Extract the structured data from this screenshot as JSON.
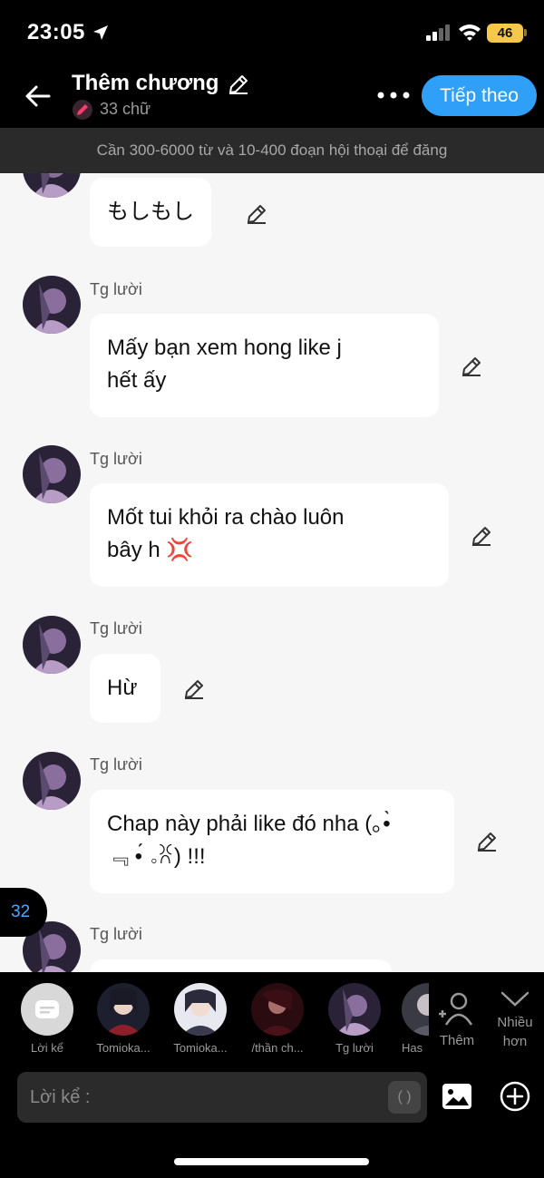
{
  "status": {
    "time": "23:05",
    "battery": "46"
  },
  "header": {
    "title": "Thêm chương",
    "word_count": "33 chữ",
    "next_label": "Tiếp theo"
  },
  "notice": "Cần 300-6000 từ và 10-400 đoạn hội thoại để đăng",
  "messages": [
    {
      "name": "",
      "lines": [
        "もしもし"
      ]
    },
    {
      "name": "Tg lười",
      "lines": [
        "Mấy bạn xem hong like j",
        "hết ấy"
      ]
    },
    {
      "name": "Tg lười",
      "lines": [
        "Mốt tui khỏi ra chào luôn",
        "bây h 💢"
      ]
    },
    {
      "name": "Tg lười",
      "lines": [
        "Hừ"
      ]
    },
    {
      "name": "Tg lười",
      "lines": [
        "Chap này phải like đó nha (｡•̀",
        "﹃ •́ ｡ꐦ) !!!"
      ]
    },
    {
      "name": "Tg lười",
      "lines": [
        ""
      ]
    }
  ],
  "side_badge": "32",
  "characters": [
    {
      "label": "Lời kể",
      "icon": "narrator-icon"
    },
    {
      "label": "Tomioka...",
      "icon": "avatar"
    },
    {
      "label": "Tomioka...",
      "icon": "avatar"
    },
    {
      "label": "/thần ch...",
      "icon": "avatar"
    },
    {
      "label": "Tg lười",
      "icon": "avatar"
    },
    {
      "label": "Has",
      "icon": "avatar"
    }
  ],
  "add_character": "Thêm",
  "more_characters": "Nhiều hơn",
  "input": {
    "placeholder": "Lời kể :",
    "paren": "( )"
  },
  "colors": {
    "accent": "#2f9ff8",
    "battery": "#f5c84a",
    "badge_text": "#4aa8ff"
  }
}
